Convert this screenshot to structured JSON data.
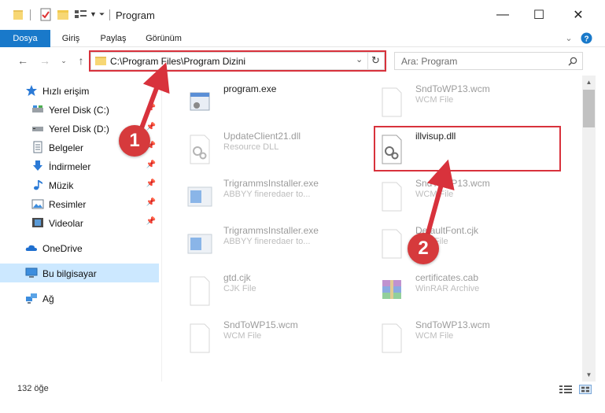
{
  "window": {
    "title": "Program",
    "minimize_glyph": "—",
    "maximize_glyph": "☐",
    "close_glyph": "✕"
  },
  "ribbon": {
    "tabs": [
      "Dosya",
      "Giriş",
      "Paylaş",
      "Görünüm"
    ]
  },
  "address": {
    "path": "C:\\Program Files\\Program Dizini",
    "search_placeholder": "Ara: Program"
  },
  "sidebar": {
    "items": [
      {
        "label": "Hızlı erişim",
        "icon": "star-icon"
      },
      {
        "label": "Yerel Disk (C:)",
        "icon": "drive-icon",
        "pinned": true
      },
      {
        "label": "Yerel Disk (D:)",
        "icon": "drive-icon",
        "pinned": true
      },
      {
        "label": "Belgeler",
        "icon": "documents-icon",
        "pinned": true
      },
      {
        "label": "İndirmeler",
        "icon": "download-icon",
        "pinned": true
      },
      {
        "label": "Müzik",
        "icon": "music-icon",
        "pinned": true
      },
      {
        "label": "Resimler",
        "icon": "pictures-icon",
        "pinned": true
      },
      {
        "label": "Videolar",
        "icon": "videos-icon",
        "pinned": true
      },
      {
        "label": "OneDrive",
        "icon": "onedrive-icon"
      },
      {
        "label": "Bu bilgisayar",
        "icon": "computer-icon",
        "selected": true
      },
      {
        "label": "Ağ",
        "icon": "network-icon"
      }
    ]
  },
  "files": [
    {
      "name": "program.exe",
      "type": "",
      "icon": "exe-icon"
    },
    {
      "name": "SndToWP13.wcm",
      "type": "WCM File",
      "icon": "blank-file-icon"
    },
    {
      "name": "UpdateClient21.dll",
      "type": "Resource DLL",
      "icon": "dll-icon"
    },
    {
      "name": "illvisup.dll",
      "type": "",
      "icon": "dll-icon"
    },
    {
      "name": "TrigrammsInstaller.exe",
      "type": "ABBYY fineredaer to...",
      "icon": "installer-icon"
    },
    {
      "name": "SndToWP13.wcm",
      "type": "WCM File",
      "icon": "blank-file-icon"
    },
    {
      "name": "TrigrammsInstaller.exe",
      "type": "ABBYY fineredaer to...",
      "icon": "installer-icon"
    },
    {
      "name": "DefaultFont.cjk",
      "type": "CJK File",
      "icon": "blank-file-icon"
    },
    {
      "name": "gtd.cjk",
      "type": "CJK File",
      "icon": "blank-file-icon"
    },
    {
      "name": "certificates.cab",
      "type": "WinRAR Archive",
      "icon": "winrar-icon"
    },
    {
      "name": "SndToWP15.wcm",
      "type": "WCM File",
      "icon": "blank-file-icon"
    },
    {
      "name": "SndToWP13.wcm",
      "type": "WCM File",
      "icon": "blank-file-icon"
    }
  ],
  "status": {
    "item_count": "132 öğe"
  },
  "annotations": {
    "step1": "1",
    "step2": "2",
    "color": "#d8323c"
  }
}
